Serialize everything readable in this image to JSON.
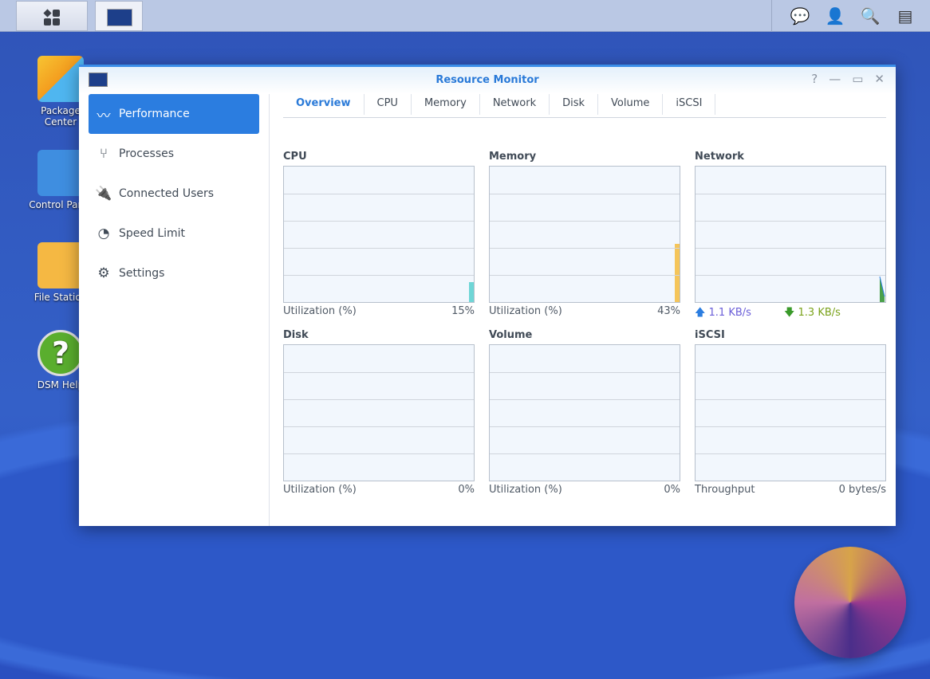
{
  "taskbar": {
    "right_icons": [
      "chat-icon",
      "user-icon",
      "search-icon",
      "widgets-icon"
    ]
  },
  "desktop": {
    "icons": [
      {
        "label": "Package Center"
      },
      {
        "label": "Control Panel"
      },
      {
        "label": "File Station"
      },
      {
        "label": "DSM Help"
      }
    ]
  },
  "window": {
    "title": "Resource Monitor"
  },
  "sidebar": {
    "items": [
      {
        "label": "Performance"
      },
      {
        "label": "Processes"
      },
      {
        "label": "Connected Users"
      },
      {
        "label": "Speed Limit"
      },
      {
        "label": "Settings"
      }
    ]
  },
  "tabs": [
    "Overview",
    "CPU",
    "Memory",
    "Network",
    "Disk",
    "Volume",
    "iSCSI"
  ],
  "panels": {
    "cpu": {
      "title": "CPU",
      "label": "Utilization (%)",
      "value": "15%",
      "percent": 15,
      "color": "#6fd6d6"
    },
    "memory": {
      "title": "Memory",
      "label": "Utilization (%)",
      "value": "43%",
      "percent": 43,
      "color": "#f5c55a"
    },
    "network": {
      "title": "Network",
      "upload": "1.1 KB/s",
      "download": "1.3 KB/s",
      "up_color": "#2b7de0",
      "down_color": "#3a9a2a"
    },
    "disk": {
      "title": "Disk",
      "label": "Utilization (%)",
      "value": "0%"
    },
    "volume": {
      "title": "Volume",
      "label": "Utilization (%)",
      "value": "0%"
    },
    "iscsi": {
      "title": "iSCSI",
      "label": "Throughput",
      "value": "0 bytes/s"
    }
  }
}
